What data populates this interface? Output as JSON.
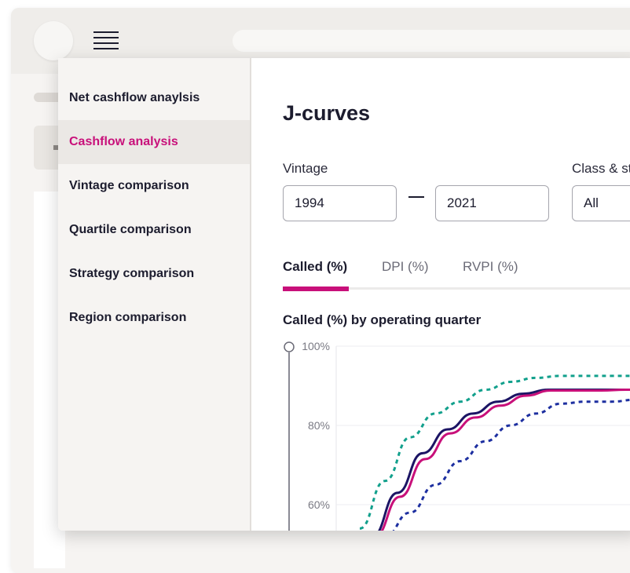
{
  "menu": {
    "items": [
      {
        "label": "Net cashflow anaylsis",
        "active": false
      },
      {
        "label": "Cashflow analysis",
        "active": true
      },
      {
        "label": "Vintage comparison",
        "active": false
      },
      {
        "label": "Quartile comparison",
        "active": false
      },
      {
        "label": "Strategy comparison",
        "active": false
      },
      {
        "label": "Region comparison",
        "active": false
      }
    ]
  },
  "page": {
    "title": "J-curves",
    "vintage": {
      "label": "Vintage",
      "from": "1994",
      "to": "2021"
    },
    "class_strategy": {
      "label": "Class & st",
      "value": "All"
    },
    "tabs": [
      {
        "label": "Called (%)",
        "active": true
      },
      {
        "label": "DPI (%)",
        "active": false
      },
      {
        "label": "RVPI (%)",
        "active": false
      }
    ]
  },
  "colors": {
    "accent": "#c8107a",
    "navy": "#1b1464",
    "teal": "#12a08c",
    "blue": "#1d2fa0"
  },
  "chart_data": {
    "type": "line",
    "title": "Called (%) by operating quarter",
    "xlabel": "",
    "ylabel": "",
    "ylim": [
      52,
      100
    ],
    "xlim": [
      0,
      18
    ],
    "y_ticks": [
      "100%",
      "80%",
      "60%"
    ],
    "y_tick_values": [
      100,
      80,
      60
    ],
    "grid": true,
    "series": [
      {
        "color": "#12a08c",
        "style": "dashed",
        "points": [
          [
            1,
            54
          ],
          [
            2,
            66
          ],
          [
            3,
            77
          ],
          [
            4,
            83
          ],
          [
            5,
            86
          ],
          [
            6,
            89
          ],
          [
            7,
            91
          ],
          [
            8,
            92
          ],
          [
            9,
            92.5
          ],
          [
            10,
            92.5
          ],
          [
            11,
            92.5
          ],
          [
            12,
            92.5
          ],
          [
            13,
            92.5
          ]
        ]
      },
      {
        "color": "#1b1464",
        "style": "solid",
        "points": [
          [
            1.5,
            52
          ],
          [
            2.5,
            63
          ],
          [
            3.5,
            73
          ],
          [
            4.5,
            79
          ],
          [
            5.5,
            83
          ],
          [
            6.5,
            86
          ],
          [
            7.5,
            88
          ],
          [
            8.5,
            89
          ],
          [
            9.5,
            89
          ],
          [
            10.5,
            89
          ],
          [
            11.5,
            89
          ],
          [
            13,
            89.2
          ]
        ]
      },
      {
        "color": "#c8107a",
        "style": "solid",
        "points": [
          [
            1.6,
            52
          ],
          [
            2.6,
            62
          ],
          [
            3.6,
            71.5
          ],
          [
            4.6,
            78
          ],
          [
            5.6,
            82
          ],
          [
            6.6,
            85
          ],
          [
            7.6,
            87.5
          ],
          [
            8.6,
            88.8
          ],
          [
            9.6,
            88.8
          ],
          [
            10.6,
            88.8
          ],
          [
            11.6,
            89
          ],
          [
            13,
            89.2
          ]
        ]
      },
      {
        "color": "#1d2fa0",
        "style": "dashed",
        "points": [
          [
            2,
            52
          ],
          [
            3,
            58
          ],
          [
            4,
            65
          ],
          [
            5,
            71
          ],
          [
            6,
            76
          ],
          [
            7,
            80
          ],
          [
            8,
            83
          ],
          [
            9,
            85.5
          ],
          [
            10,
            86
          ],
          [
            11,
            86
          ],
          [
            12,
            86.5
          ],
          [
            13,
            86.5
          ]
        ]
      }
    ]
  }
}
